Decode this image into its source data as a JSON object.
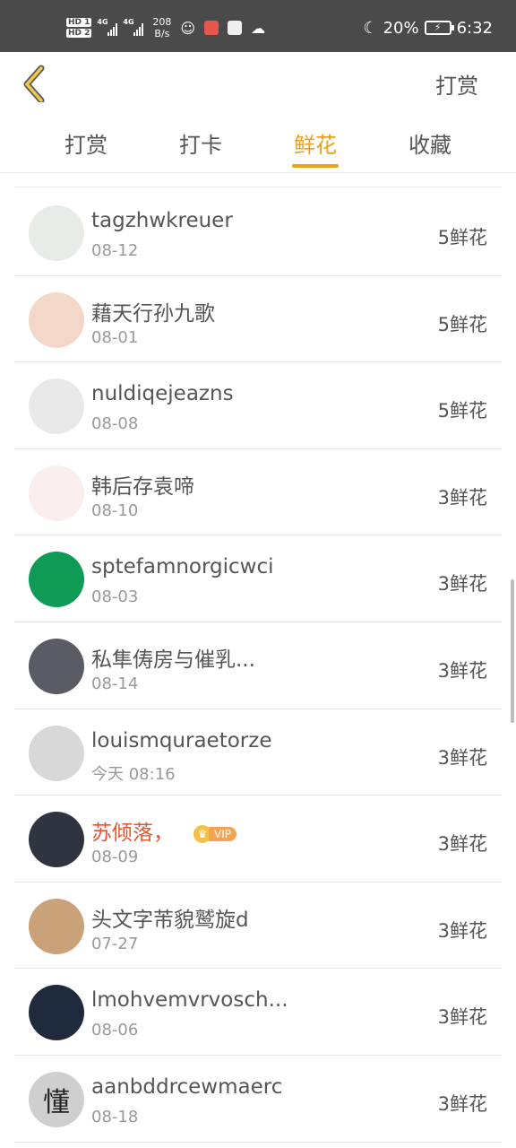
{
  "statusbar": {
    "hd1": "HD 1",
    "hd2": "HD 2",
    "net1": "4G",
    "net2": "4G",
    "speed_value": "208",
    "speed_unit": "B/s",
    "battery": "20%",
    "time": "6:32"
  },
  "header": {
    "right_action": "打赏"
  },
  "tabs": [
    {
      "label": "打赏",
      "active": false
    },
    {
      "label": "打卡",
      "active": false
    },
    {
      "label": "鲜花",
      "active": true
    },
    {
      "label": "收藏",
      "active": false
    }
  ],
  "rows": [
    {
      "name": "tagzhwkreuer",
      "date": "08-12",
      "amount": "5鲜花",
      "avatar_color": "#e7ece8"
    },
    {
      "name": "藉天行孙九歌",
      "date": "08-01",
      "amount": "5鲜花",
      "avatar_color": "#f3d7c8"
    },
    {
      "name": "nuldiqejeazns",
      "date": "08-08",
      "amount": "5鲜花",
      "avatar_color": "#e9e9e9"
    },
    {
      "name": "韩后存袁啼",
      "date": "08-10",
      "amount": "3鲜花",
      "avatar_color": "#fbeeee"
    },
    {
      "name": "sptefamnorgicwci",
      "date": "08-03",
      "amount": "3鲜花",
      "avatar_color": "#0f9a56"
    },
    {
      "name": "私隼俦房与催乳...",
      "date": "08-14",
      "amount": "3鲜花",
      "avatar_color": "#5b5b66"
    },
    {
      "name": "louismquraetorze",
      "date": "今天 08:16",
      "amount": "3鲜花",
      "avatar_color": "#d8d8d8"
    },
    {
      "name": "苏倾落，",
      "date": "08-09",
      "amount": "3鲜花",
      "avatar_color": "#2f3540",
      "vip": "VIP"
    },
    {
      "name": "头文字芾貌鹫旋d",
      "date": "07-27",
      "amount": "3鲜花",
      "avatar_color": "#c9a27a"
    },
    {
      "name": "lmohvemvrvosch...",
      "date": "08-06",
      "amount": "3鲜花",
      "avatar_color": "#1f2b3d"
    },
    {
      "name": "aanbddrcewmaerc",
      "date": "08-18",
      "amount": "3鲜花",
      "avatar_color": "#cfcfcf",
      "avatar_char": "懂"
    }
  ],
  "colors": {
    "accent": "#e9a11b",
    "vip_name": "#e8542e",
    "statusbar": "#4a4a4a"
  }
}
